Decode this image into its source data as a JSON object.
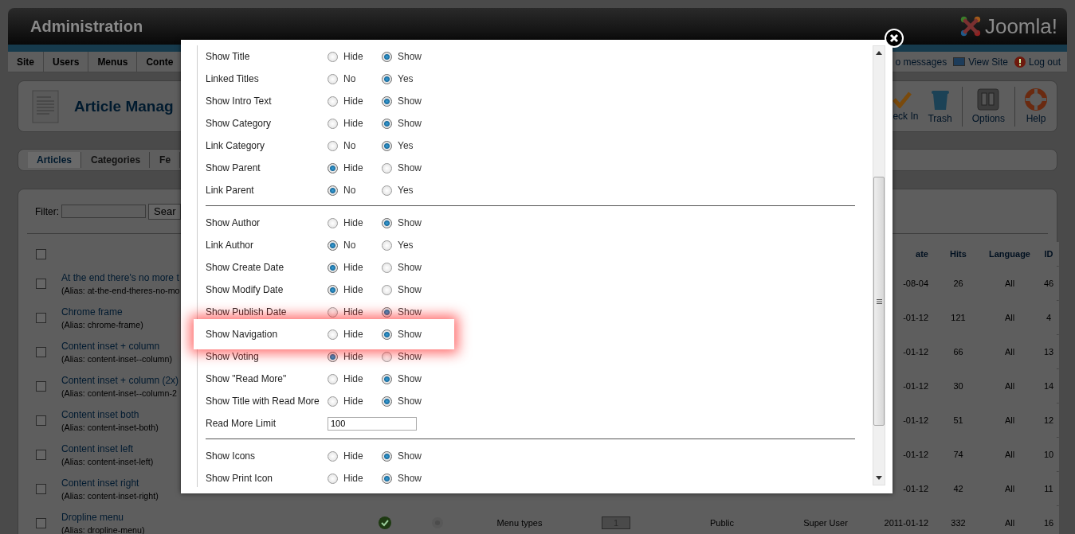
{
  "header": {
    "title": "Administration",
    "logo": "Joomla!"
  },
  "menu": [
    {
      "label": "Site"
    },
    {
      "label": "Users"
    },
    {
      "label": "Menus"
    },
    {
      "label": "Conte"
    }
  ],
  "status_links": [
    {
      "label": "o messages",
      "kind": "messages"
    },
    {
      "label": "View Site",
      "kind": "view"
    },
    {
      "label": "Log out",
      "kind": "logout"
    }
  ],
  "toolbar": {
    "title": "Article Manag",
    "buttons": [
      {
        "label": "eck In",
        "kind": "checkin"
      },
      {
        "label": "Trash",
        "kind": "trash"
      },
      {
        "label": "Options",
        "kind": "options"
      },
      {
        "label": "Help",
        "kind": "help"
      }
    ]
  },
  "submenu": [
    {
      "label": "Articles",
      "selected": true
    },
    {
      "label": "Categories",
      "selected": false
    },
    {
      "label": "Fe",
      "selected": false
    }
  ],
  "filter": {
    "label": "Filter:",
    "button": "Sear"
  },
  "table": {
    "select_all_checked": false,
    "columns_right": [
      "ate",
      "Hits",
      "Language",
      "ID"
    ],
    "rows": [
      {
        "checked": false,
        "title": "At the end there's no more t",
        "alias": "(Alias: at-the-end-theres-no-mo",
        "date": "-08-04",
        "hits": "26",
        "language": "All",
        "id": "46"
      },
      {
        "checked": false,
        "title": "Chrome frame",
        "alias": "(Alias: chrome-frame)",
        "date": "-01-12",
        "hits": "121",
        "language": "All",
        "id": "4"
      },
      {
        "checked": false,
        "title": "Content inset + column",
        "alias": "(Alias: content-inset--column)",
        "date": "-01-12",
        "hits": "66",
        "language": "All",
        "id": "13"
      },
      {
        "checked": false,
        "title": "Content inset + column (2x)",
        "alias": "(Alias: content-inset--column-2",
        "date": "-01-12",
        "hits": "30",
        "language": "All",
        "id": "14"
      },
      {
        "checked": false,
        "title": "Content inset both",
        "alias": "(Alias: content-inset-both)",
        "date": "-01-12",
        "hits": "51",
        "language": "All",
        "id": "12"
      },
      {
        "checked": false,
        "title": "Content inset left",
        "alias": "(Alias: content-inset-left)",
        "date": "-01-12",
        "hits": "74",
        "language": "All",
        "id": "10"
      },
      {
        "checked": false,
        "title": "Content inset right",
        "alias": "(Alias: content-inset-right)",
        "date": "-01-12",
        "hits": "42",
        "language": "All",
        "id": "11"
      },
      {
        "checked": false,
        "title": "Dropline menu",
        "alias": "(Alias: dropline-menu)",
        "published": true,
        "featured": false,
        "category": "Menu types",
        "order": "1",
        "access": "Public",
        "author": "Super User",
        "date": "2011-01-12",
        "hits": "332",
        "language": "All",
        "id": "16"
      }
    ]
  },
  "dialog": {
    "sections": [
      {
        "rows": [
          {
            "label": "Show Title",
            "kind": "radio",
            "highlighted": false,
            "options": [
              {
                "label": "Hide",
                "selected": false
              },
              {
                "label": "Show",
                "selected": true
              }
            ]
          },
          {
            "label": "Linked Titles",
            "kind": "radio",
            "highlighted": false,
            "options": [
              {
                "label": "No",
                "selected": false
              },
              {
                "label": "Yes",
                "selected": true
              }
            ]
          },
          {
            "label": "Show Intro Text",
            "kind": "radio",
            "highlighted": false,
            "options": [
              {
                "label": "Hide",
                "selected": false
              },
              {
                "label": "Show",
                "selected": true
              }
            ]
          },
          {
            "label": "Show Category",
            "kind": "radio",
            "highlighted": false,
            "options": [
              {
                "label": "Hide",
                "selected": false
              },
              {
                "label": "Show",
                "selected": true
              }
            ]
          },
          {
            "label": "Link Category",
            "kind": "radio",
            "highlighted": false,
            "options": [
              {
                "label": "No",
                "selected": false
              },
              {
                "label": "Yes",
                "selected": true
              }
            ]
          },
          {
            "label": "Show Parent",
            "kind": "radio",
            "highlighted": false,
            "options": [
              {
                "label": "Hide",
                "selected": true
              },
              {
                "label": "Show",
                "selected": false
              }
            ]
          },
          {
            "label": "Link Parent",
            "kind": "radio",
            "highlighted": false,
            "options": [
              {
                "label": "No",
                "selected": true
              },
              {
                "label": "Yes",
                "selected": false
              }
            ]
          }
        ]
      },
      {
        "rows": [
          {
            "label": "Show Author",
            "kind": "radio",
            "highlighted": false,
            "options": [
              {
                "label": "Hide",
                "selected": false
              },
              {
                "label": "Show",
                "selected": true
              }
            ]
          },
          {
            "label": "Link Author",
            "kind": "radio",
            "highlighted": false,
            "options": [
              {
                "label": "No",
                "selected": true
              },
              {
                "label": "Yes",
                "selected": false
              }
            ]
          },
          {
            "label": "Show Create Date",
            "kind": "radio",
            "highlighted": false,
            "options": [
              {
                "label": "Hide",
                "selected": true
              },
              {
                "label": "Show",
                "selected": false
              }
            ]
          },
          {
            "label": "Show Modify Date",
            "kind": "radio",
            "highlighted": false,
            "options": [
              {
                "label": "Hide",
                "selected": true
              },
              {
                "label": "Show",
                "selected": false
              }
            ]
          },
          {
            "label": "Show Publish Date",
            "kind": "radio",
            "highlighted": false,
            "options": [
              {
                "label": "Hide",
                "selected": false
              },
              {
                "label": "Show",
                "selected": true
              }
            ]
          },
          {
            "label": "Show Navigation",
            "kind": "radio",
            "highlighted": true,
            "options": [
              {
                "label": "Hide",
                "selected": false
              },
              {
                "label": "Show",
                "selected": true
              }
            ]
          },
          {
            "label": "Show Voting",
            "kind": "radio",
            "highlighted": false,
            "options": [
              {
                "label": "Hide",
                "selected": true
              },
              {
                "label": "Show",
                "selected": false
              }
            ]
          },
          {
            "label": "Show \"Read More\"",
            "kind": "radio",
            "highlighted": false,
            "options": [
              {
                "label": "Hide",
                "selected": false
              },
              {
                "label": "Show",
                "selected": true
              }
            ]
          },
          {
            "label": "Show Title with Read More",
            "kind": "radio",
            "highlighted": false,
            "options": [
              {
                "label": "Hide",
                "selected": false
              },
              {
                "label": "Show",
                "selected": true
              }
            ]
          },
          {
            "label": "Read More Limit",
            "kind": "text",
            "highlighted": false,
            "value": "100"
          }
        ]
      },
      {
        "rows": [
          {
            "label": "Show Icons",
            "kind": "radio",
            "highlighted": false,
            "options": [
              {
                "label": "Hide",
                "selected": false
              },
              {
                "label": "Show",
                "selected": true
              }
            ]
          },
          {
            "label": "Show Print Icon",
            "kind": "radio",
            "highlighted": false,
            "options": [
              {
                "label": "Hide",
                "selected": false
              },
              {
                "label": "Show",
                "selected": true
              }
            ]
          }
        ]
      }
    ]
  }
}
